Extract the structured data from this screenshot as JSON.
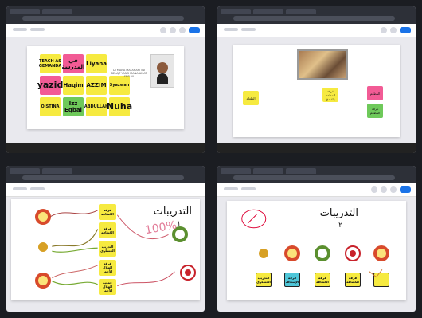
{
  "panel1": {
    "stickies": [
      {
        "label": "TEACH AS GEMANDA",
        "color": "yellow",
        "size": "small"
      },
      {
        "label": "في المدرسة",
        "color": "pink",
        "size": "normal"
      },
      {
        "label": "Liyana",
        "color": "yellow",
        "size": "normal"
      },
      {
        "label": "",
        "color": "none",
        "size": "normal"
      },
      {
        "label": "yazid",
        "color": "pink",
        "size": "big"
      },
      {
        "label": "Haqim",
        "color": "yellow",
        "size": "normal"
      },
      {
        "label": "AZZIM",
        "color": "yellow",
        "size": "normal"
      },
      {
        "label": "Syazwan",
        "color": "yellow",
        "size": "small"
      },
      {
        "label": "QISTINA",
        "color": "yellow",
        "size": "small"
      },
      {
        "label": "Izz Eqbal",
        "color": "green",
        "size": "normal"
      },
      {
        "label": "ABDULLAH",
        "color": "yellow",
        "size": "small"
      },
      {
        "label": "Nuha",
        "color": "yellow",
        "size": "big"
      }
    ],
    "caption": "DI MANA MATAHARI INI BELAJ? YANG MANA AMAT SESUAI"
  },
  "panel2": {
    "stickies": [
      {
        "label": "الطعام",
        "color": "yellow"
      },
      {
        "label": "غرفة المطعم بالفندق",
        "color": "yellow"
      },
      {
        "label": "المطعم",
        "color": "pink"
      },
      {
        "label": "غرفة المطعم",
        "color": "green"
      }
    ]
  },
  "panel3": {
    "heading": "التدريبات",
    "number": "١",
    "stickies": [
      {
        "label": "فرقة الكشافة",
        "color": "yellow"
      },
      {
        "label": "فرقة الكشافة",
        "color": "yellow"
      },
      {
        "label": "التدريب العسكري",
        "color": "yellow"
      },
      {
        "label": "فرقة الهلال الأحمر",
        "color": "yellow"
      },
      {
        "label": "جمعية الهلال الأحمر",
        "color": "yellow"
      }
    ],
    "annotation": "100%"
  },
  "panel4": {
    "heading": "التدريبات",
    "number": "٢",
    "stickies": [
      {
        "label": "التدريب العسكري",
        "color": "yellow"
      },
      {
        "label": "فرقة الإسعاف",
        "color": "cyan"
      },
      {
        "label": "فرقة الكشافة",
        "color": "yellow"
      },
      {
        "label": "فرقة الكشافة",
        "color": "yellow"
      },
      {
        "label": "",
        "color": "yellow"
      }
    ]
  }
}
